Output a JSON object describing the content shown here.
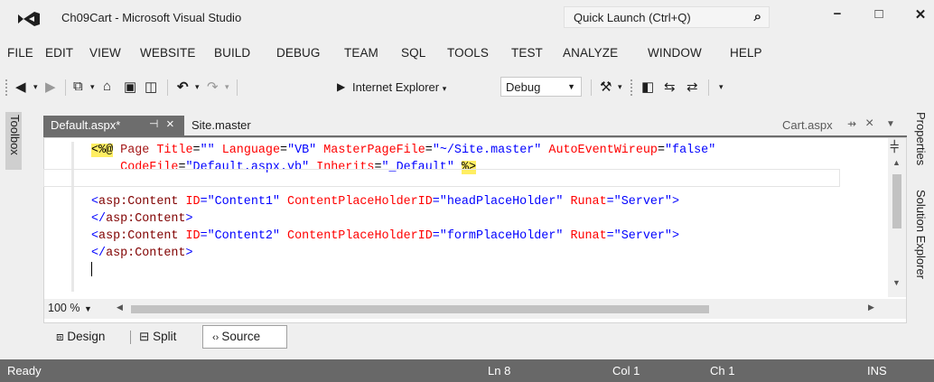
{
  "window": {
    "title": "Ch09Cart - Microsoft Visual Studio",
    "quick_launch_placeholder": "Quick Launch (Ctrl+Q)",
    "minimize": "−",
    "maximize": "□",
    "close": "✕"
  },
  "menu": [
    "FILE",
    "EDIT",
    "VIEW",
    "WEBSITE",
    "BUILD",
    "DEBUG",
    "TEAM",
    "SQL",
    "TOOLS",
    "TEST",
    "ANALYZE",
    "WINDOW",
    "HELP"
  ],
  "toolbar": {
    "browser_label": "Internet Explorer",
    "configuration": "Debug"
  },
  "side_panels": {
    "left": "Toolbox",
    "right_top": "Properties",
    "right_bottom": "Solution Explorer"
  },
  "tabs": {
    "active": "Default.aspx*",
    "inactive": "Site.master",
    "preview": "Cart.aspx"
  },
  "editor": {
    "lines": [
      {
        "type": "directive",
        "parts": [
          {
            "cls": "c-dir",
            "t": "<%@"
          },
          {
            "cls": "c-plain",
            "t": " "
          },
          {
            "cls": "c-kw",
            "t": "Page"
          },
          {
            "cls": "c-plain",
            "t": " "
          },
          {
            "cls": "c-attr",
            "t": "Title"
          },
          {
            "cls": "c-plain",
            "t": "="
          },
          {
            "cls": "c-val",
            "t": "\"\""
          },
          {
            "cls": "c-plain",
            "t": " "
          },
          {
            "cls": "c-attr",
            "t": "Language"
          },
          {
            "cls": "c-plain",
            "t": "="
          },
          {
            "cls": "c-val",
            "t": "\"VB\""
          },
          {
            "cls": "c-plain",
            "t": " "
          },
          {
            "cls": "c-attr",
            "t": "MasterPageFile"
          },
          {
            "cls": "c-plain",
            "t": "="
          },
          {
            "cls": "c-val",
            "t": "\"~/Site.master\""
          },
          {
            "cls": "c-plain",
            "t": " "
          },
          {
            "cls": "c-attr",
            "t": "AutoEventWireup"
          },
          {
            "cls": "c-plain",
            "t": "="
          },
          {
            "cls": "c-val",
            "t": "\"false\""
          }
        ]
      },
      {
        "type": "directive2",
        "parts": [
          {
            "cls": "c-plain",
            "t": "    "
          },
          {
            "cls": "c-attr",
            "t": "CodeFile"
          },
          {
            "cls": "c-plain",
            "t": "="
          },
          {
            "cls": "c-val",
            "t": "\"Default.aspx.vb\""
          },
          {
            "cls": "c-plain",
            "t": " "
          },
          {
            "cls": "c-attr",
            "t": "Inherits"
          },
          {
            "cls": "c-plain",
            "t": "="
          },
          {
            "cls": "c-val",
            "t": "\"_Default\""
          },
          {
            "cls": "c-plain",
            "t": " "
          },
          {
            "cls": "c-dir",
            "t": "%>"
          }
        ]
      },
      {
        "type": "blank",
        "parts": []
      },
      {
        "type": "tag",
        "parts": [
          {
            "cls": "c-val",
            "t": "<"
          },
          {
            "cls": "c-tag",
            "t": "asp:Content"
          },
          {
            "cls": "c-plain",
            "t": " "
          },
          {
            "cls": "c-attr",
            "t": "ID"
          },
          {
            "cls": "c-val",
            "t": "=\"Content1\""
          },
          {
            "cls": "c-plain",
            "t": " "
          },
          {
            "cls": "c-attr",
            "t": "ContentPlaceHolderID"
          },
          {
            "cls": "c-val",
            "t": "=\"headPlaceHolder\""
          },
          {
            "cls": "c-plain",
            "t": " "
          },
          {
            "cls": "c-attr",
            "t": "Runat"
          },
          {
            "cls": "c-val",
            "t": "=\"Server\">"
          }
        ]
      },
      {
        "type": "tag",
        "parts": [
          {
            "cls": "c-val",
            "t": "</"
          },
          {
            "cls": "c-tag",
            "t": "asp:Content"
          },
          {
            "cls": "c-val",
            "t": ">"
          }
        ]
      },
      {
        "type": "tag",
        "parts": [
          {
            "cls": "c-val",
            "t": "<"
          },
          {
            "cls": "c-tag",
            "t": "asp:Content"
          },
          {
            "cls": "c-plain",
            "t": " "
          },
          {
            "cls": "c-attr",
            "t": "ID"
          },
          {
            "cls": "c-val",
            "t": "=\"Content2\""
          },
          {
            "cls": "c-plain",
            "t": " "
          },
          {
            "cls": "c-attr",
            "t": "ContentPlaceHolderID"
          },
          {
            "cls": "c-val",
            "t": "=\"formPlaceHolder\""
          },
          {
            "cls": "c-plain",
            "t": " "
          },
          {
            "cls": "c-attr",
            "t": "Runat"
          },
          {
            "cls": "c-val",
            "t": "=\"Server\">"
          }
        ]
      },
      {
        "type": "tag",
        "parts": [
          {
            "cls": "c-val",
            "t": "</"
          },
          {
            "cls": "c-tag",
            "t": "asp:Content"
          },
          {
            "cls": "c-val",
            "t": ">"
          }
        ]
      }
    ],
    "zoom": "100 %"
  },
  "view_tabs": {
    "design": "Design",
    "split": "Split",
    "source": "Source"
  },
  "status": {
    "state": "Ready",
    "line": "Ln 8",
    "col": "Col 1",
    "ch": "Ch 1",
    "mode": "INS"
  },
  "icons": [
    "vs-logo-icon",
    "search-icon",
    "back-icon",
    "forward-icon",
    "new-project-icon",
    "open-icon",
    "save-icon",
    "save-all-icon",
    "undo-icon",
    "redo-icon",
    "start-icon",
    "pin-icon",
    "close-icon"
  ]
}
